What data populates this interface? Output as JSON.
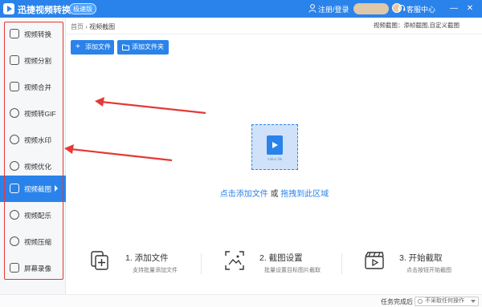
{
  "titlebar": {
    "app_title": "迅捷视频转换器",
    "edition": "极速版",
    "login": "注册/登录",
    "service": "客服中心",
    "minimize": "—",
    "close": "✕"
  },
  "sidebar": {
    "items": [
      {
        "label": "视频转换",
        "icon": "convert-icon"
      },
      {
        "label": "视频分割",
        "icon": "split-icon"
      },
      {
        "label": "视频合并",
        "icon": "merge-icon"
      },
      {
        "label": "视频转GIF",
        "icon": "gif-icon"
      },
      {
        "label": "视频水印",
        "icon": "watermark-icon"
      },
      {
        "label": "视频优化",
        "icon": "optimize-icon"
      },
      {
        "label": "视频截图",
        "icon": "screenshot-icon",
        "active": true
      },
      {
        "label": "视频配乐",
        "icon": "music-icon"
      },
      {
        "label": "视频压缩",
        "icon": "compress-icon"
      },
      {
        "label": "屏幕录像",
        "icon": "record-icon"
      }
    ]
  },
  "breadcrumb": {
    "home": "首页",
    "sep": "›",
    "current": "视频截图"
  },
  "header_note": "视频截图：添帧截图,自定义截图",
  "toolbar": {
    "add_file": "添加文件",
    "add_folder": "添加文件夹"
  },
  "dropzone": {
    "file_label": "Video file",
    "hint_link1": "点击添加文件",
    "hint_or": " 或 ",
    "hint_link2": "拖拽到此区域"
  },
  "steps": [
    {
      "title": "1. 添加文件",
      "desc": "支持批量添加文件"
    },
    {
      "title": "2. 截图设置",
      "desc": "批量设置目标图片截取"
    },
    {
      "title": "3. 开始截取",
      "desc": "点击按钮开始截图"
    }
  ],
  "statusbar": {
    "label": "任务完成后",
    "select": "不采取任何操作"
  },
  "colors": {
    "accent": "#2a83ea",
    "annotation": "#e53935"
  }
}
